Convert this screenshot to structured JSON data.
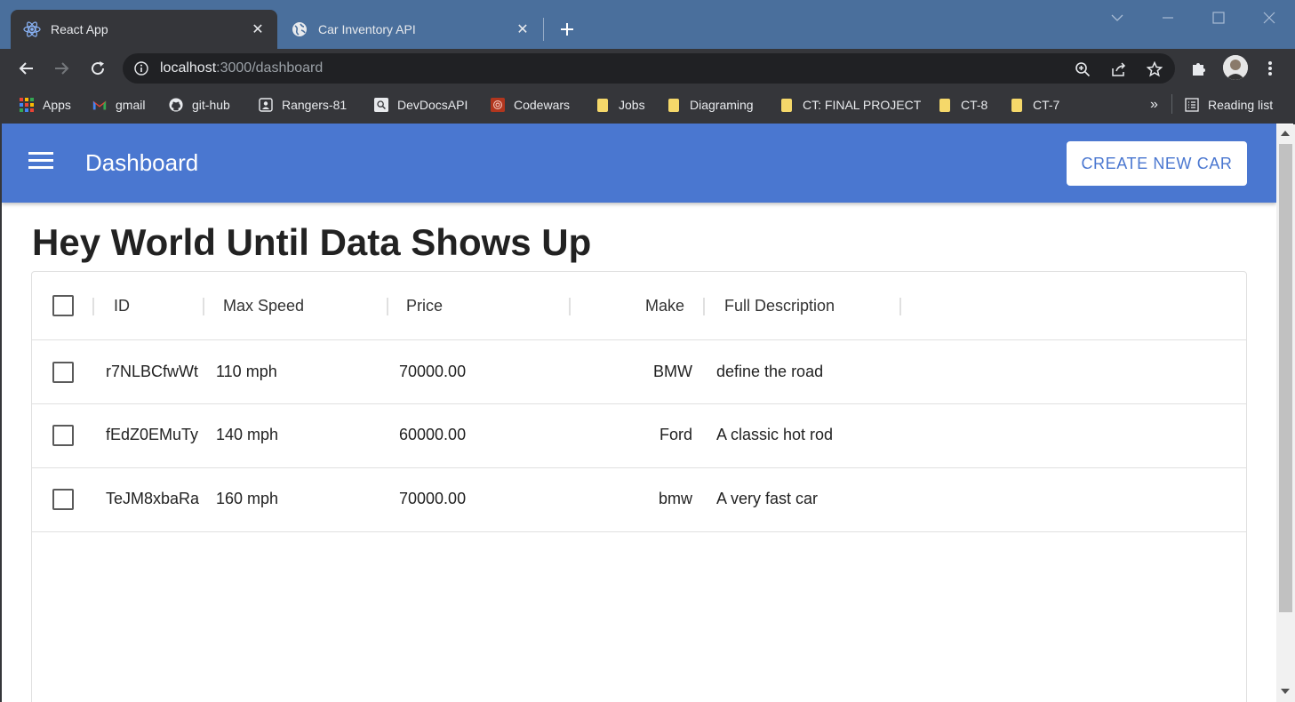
{
  "browser": {
    "tabs": [
      {
        "title": "React App",
        "icon": "react-icon",
        "active": true
      },
      {
        "title": "Car Inventory API",
        "icon": "globe-icon",
        "active": false
      }
    ],
    "url_host": "localhost",
    "url_rest": ":3000/dashboard",
    "bookmarks": [
      {
        "label": "Apps",
        "icon": "apps-grid-icon"
      },
      {
        "label": "gmail",
        "icon": "gmail-icon"
      },
      {
        "label": "git-hub",
        "icon": "github-icon"
      },
      {
        "label": "Rangers-81",
        "icon": "contact-icon"
      },
      {
        "label": "DevDocsAPI",
        "icon": "search-doc-icon"
      },
      {
        "label": "Codewars",
        "icon": "codewars-icon"
      },
      {
        "label": "Jobs",
        "icon": "folder-icon"
      },
      {
        "label": "Diagraming",
        "icon": "folder-icon"
      },
      {
        "label": "CT: FINAL PROJECT",
        "icon": "folder-icon"
      },
      {
        "label": "CT-8",
        "icon": "folder-icon"
      },
      {
        "label": "CT-7",
        "icon": "folder-icon"
      }
    ],
    "overflow_label": "»",
    "reading_list_label": "Reading list"
  },
  "app": {
    "title": "Dashboard",
    "create_button_label": "CREATE NEW CAR",
    "heading": "Hey World Until Data Shows Up",
    "accent_color": "#4a77d0"
  },
  "grid": {
    "columns": [
      "ID",
      "Max Speed",
      "Price",
      "Make",
      "Full Description"
    ],
    "rows": [
      {
        "id": "r7NLBCfwWt",
        "max_speed": "110 mph",
        "price": "70000.00",
        "make": "BMW",
        "description": "define the road"
      },
      {
        "id": "fEdZ0EMuTy",
        "max_speed": "140 mph",
        "price": "60000.00",
        "make": "Ford",
        "description": "A classic hot rod"
      },
      {
        "id": "TeJM8xbaRa",
        "max_speed": "160 mph",
        "price": "70000.00",
        "make": "bmw",
        "description": "A very fast car"
      }
    ]
  }
}
